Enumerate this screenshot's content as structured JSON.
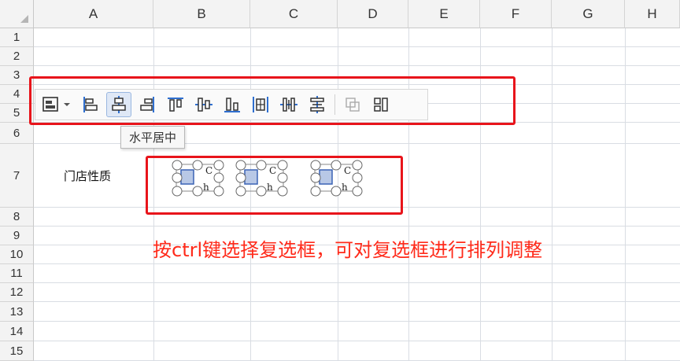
{
  "columns": [
    "A",
    "B",
    "C",
    "D",
    "E",
    "F",
    "G",
    "H"
  ],
  "rows": [
    "1",
    "2",
    "3",
    "4",
    "5",
    "6",
    "7",
    "8",
    "9",
    "10",
    "11",
    "12",
    "13",
    "14",
    "15"
  ],
  "cells": {
    "A7": "门店性质"
  },
  "toolbar": {
    "buttons": [
      {
        "icon": "align-menu-icon"
      },
      {
        "icon": "align-left-icon"
      },
      {
        "icon": "align-center-horizontal-icon",
        "active": true
      },
      {
        "icon": "align-right-icon"
      },
      {
        "icon": "align-top-icon"
      },
      {
        "icon": "align-middle-vertical-icon"
      },
      {
        "icon": "align-bottom-icon"
      },
      {
        "icon": "distribute-horizontal-icon"
      },
      {
        "icon": "distribute-vertical-icon"
      },
      {
        "icon": "distribute-vertical-alt-icon"
      },
      {
        "icon": "group-icon",
        "disabled": true
      },
      {
        "icon": "arrange-icon"
      }
    ],
    "tooltip": "水平居中"
  },
  "checkboxes": [
    {
      "top_char": "C",
      "bottom_char": "h"
    },
    {
      "top_char": "C",
      "bottom_char": "h"
    },
    {
      "top_char": "C",
      "bottom_char": "h"
    }
  ],
  "annotation": "按ctrl键选择复选框，可对复选框进行排列调整",
  "colors": {
    "accent": "#2f6fd0",
    "highlight": "#e8141b",
    "annotation": "#ff2a1a"
  }
}
